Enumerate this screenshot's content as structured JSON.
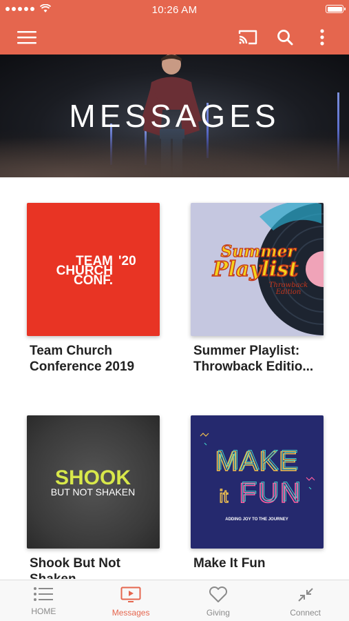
{
  "status_bar": {
    "time": "10:26 AM"
  },
  "hero": {
    "title": "MESSAGES"
  },
  "cards": [
    {
      "title": "Team Church Conference 2019",
      "art_text": [
        "TEAM",
        "CHURCH",
        "CONF.",
        "'20"
      ],
      "bg": "#e83424"
    },
    {
      "title": "Summer Playlist: Throwback Editio...",
      "art_text": [
        "Summer",
        "Playlist",
        "Throwback",
        "Edition"
      ],
      "bg": "#c5c7e0"
    },
    {
      "title": "Shook But Not Shaken",
      "art_text": [
        "SHOOK",
        "BUT NOT SHAKEN"
      ],
      "bg": "#3a3a3a"
    },
    {
      "title": "Make It Fun",
      "art_text": [
        "MAKE",
        "it",
        "FUN",
        "ADDING JOY TO THE JOURNEY"
      ],
      "bg": "#25296e"
    }
  ],
  "tabs": [
    {
      "label": "HOME",
      "icon": "list-icon",
      "active": false
    },
    {
      "label": "Messages",
      "icon": "play-screen-icon",
      "active": true
    },
    {
      "label": "Giving",
      "icon": "heart-icon",
      "active": false
    },
    {
      "label": "Connect",
      "icon": "collapse-arrows-icon",
      "active": false
    }
  ],
  "colors": {
    "accent": "#e5664e",
    "tab_inactive": "#8a8a8a"
  }
}
